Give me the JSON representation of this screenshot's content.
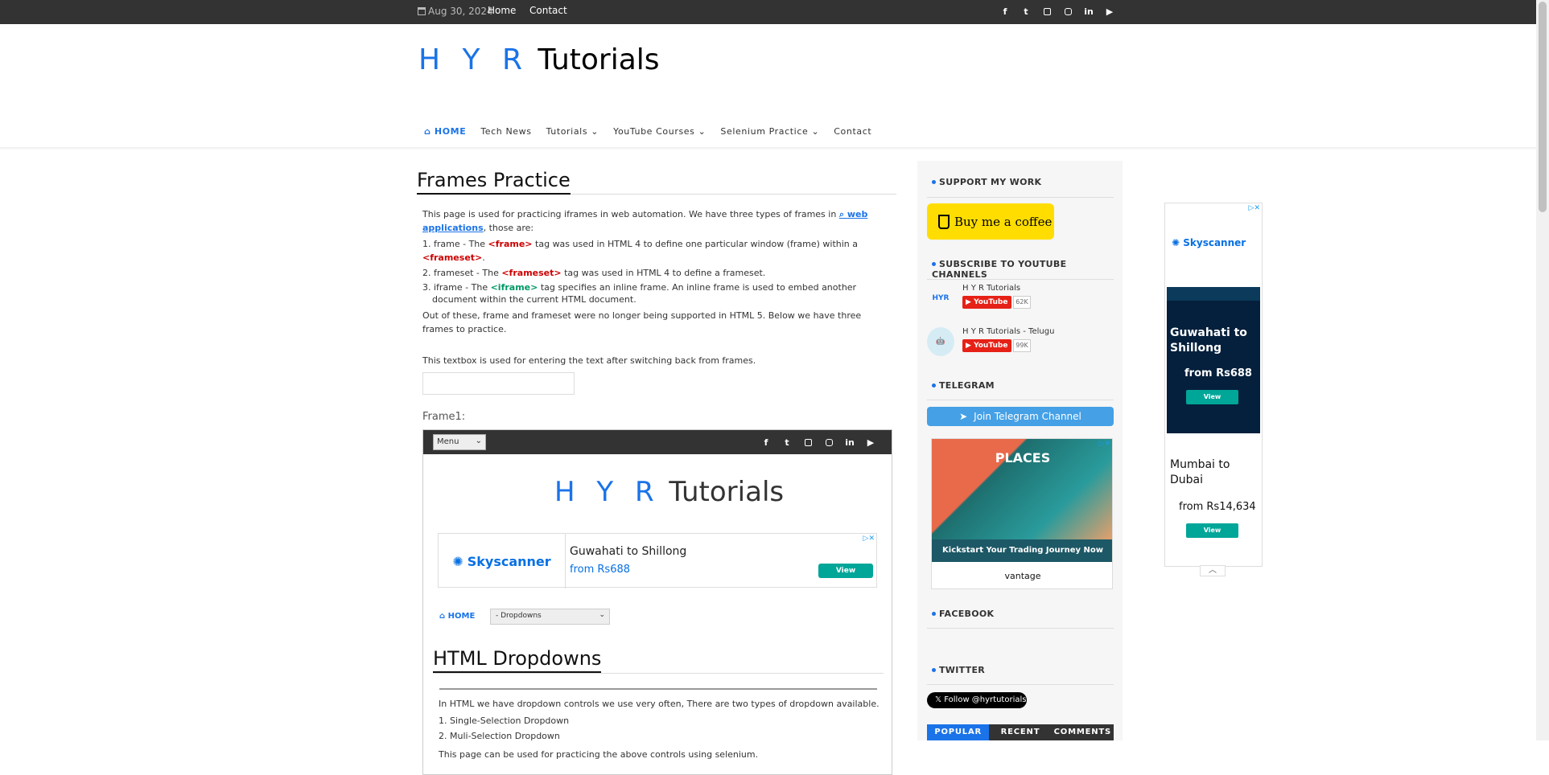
{
  "topbar": {
    "date": "Aug 30, 2024",
    "links": [
      "Home",
      "Contact"
    ],
    "social_icons": [
      "facebook-icon",
      "twitter-icon",
      "instagram-square-icon",
      "instagram-icon",
      "linkedin-icon",
      "youtube-icon"
    ]
  },
  "brand": {
    "part1": "H Y R",
    "part2": "Tutorials",
    "accent": "#1a73e8"
  },
  "nav": {
    "home": "HOME",
    "items": [
      "Tech News",
      "Tutorials",
      "YouTube Courses",
      "Selenium Practice",
      "Contact"
    ]
  },
  "main": {
    "title": "Frames Practice",
    "intro_a": "This page is used for practicing iframes in web automation. We have three types of frames in",
    "intro_link": "web applications",
    "intro_b": ", those are:",
    "item1_a": "1. frame - The",
    "item1_tag": "<frame>",
    "item1_b": "tag was used in HTML 4 to define one particular window (frame) within a",
    "item1_tag2": "<frameset>",
    "item2_a": "2. frameset - The",
    "item2_tag": "<frameset>",
    "item2_b": "tag was used in HTML 4 to define a frameset.",
    "item3_a": "3. iframe - The",
    "item3_tag": "<iframe>",
    "item3_b": "tag specifies an inline frame. An inline frame is used to embed another document within the current HTML document.",
    "outro": "Out of these, frame and frameset were no longer being supported in HTML 5. Below we have three frames to practice.",
    "textbox_label": "This textbox is used for entering the text after switching back from frames.",
    "frame_label": "Frame1:"
  },
  "frame1": {
    "menu_select": "Menu",
    "ad_brand": "Skyscanner",
    "ad_route": "Guwahati to Shillong",
    "ad_price": "from Rs688",
    "ad_view": "View",
    "home": "HOME",
    "dropdown": "- Dropdowns",
    "title": "HTML Dropdowns",
    "line1": "In HTML we have dropdown controls we use very often, There are two types of dropdown available.",
    "line2": "1. Single-Selection Dropdown",
    "line3": "2. Muli-Selection Dropdown",
    "line4": "This page can be used for practicing the above controls using selenium."
  },
  "sidebar": {
    "support": "SUPPORT MY WORK",
    "coffee": "Buy me a coffee",
    "subscribe": "SUBSCRIBE TO YOUTUBE CHANNELS",
    "channels": [
      {
        "name": "H Y R Tutorials",
        "button": "YouTube",
        "count": "62K"
      },
      {
        "name": "H Y R Tutorials - Telugu",
        "button": "YouTube",
        "count": "99K"
      }
    ],
    "telegram": "TELEGRAM",
    "telegram_button": "Join Telegram Channel",
    "ad_title": "PLACES",
    "ad_text": "Kickstart Your Trading Journey Now",
    "ad_brand": "vantage",
    "facebook": "FACEBOOK",
    "twitter": "TWITTER",
    "follow": "Follow @hyrtutorials",
    "tabs": [
      "POPULAR",
      "RECENT",
      "COMMENTS"
    ]
  },
  "right_ad": {
    "brand": "Skyscanner",
    "route1": "Guwahati to Shillong",
    "price1": "from Rs688",
    "route2": "Mumbai to Dubai",
    "price2": "from Rs14,634",
    "view": "View"
  }
}
